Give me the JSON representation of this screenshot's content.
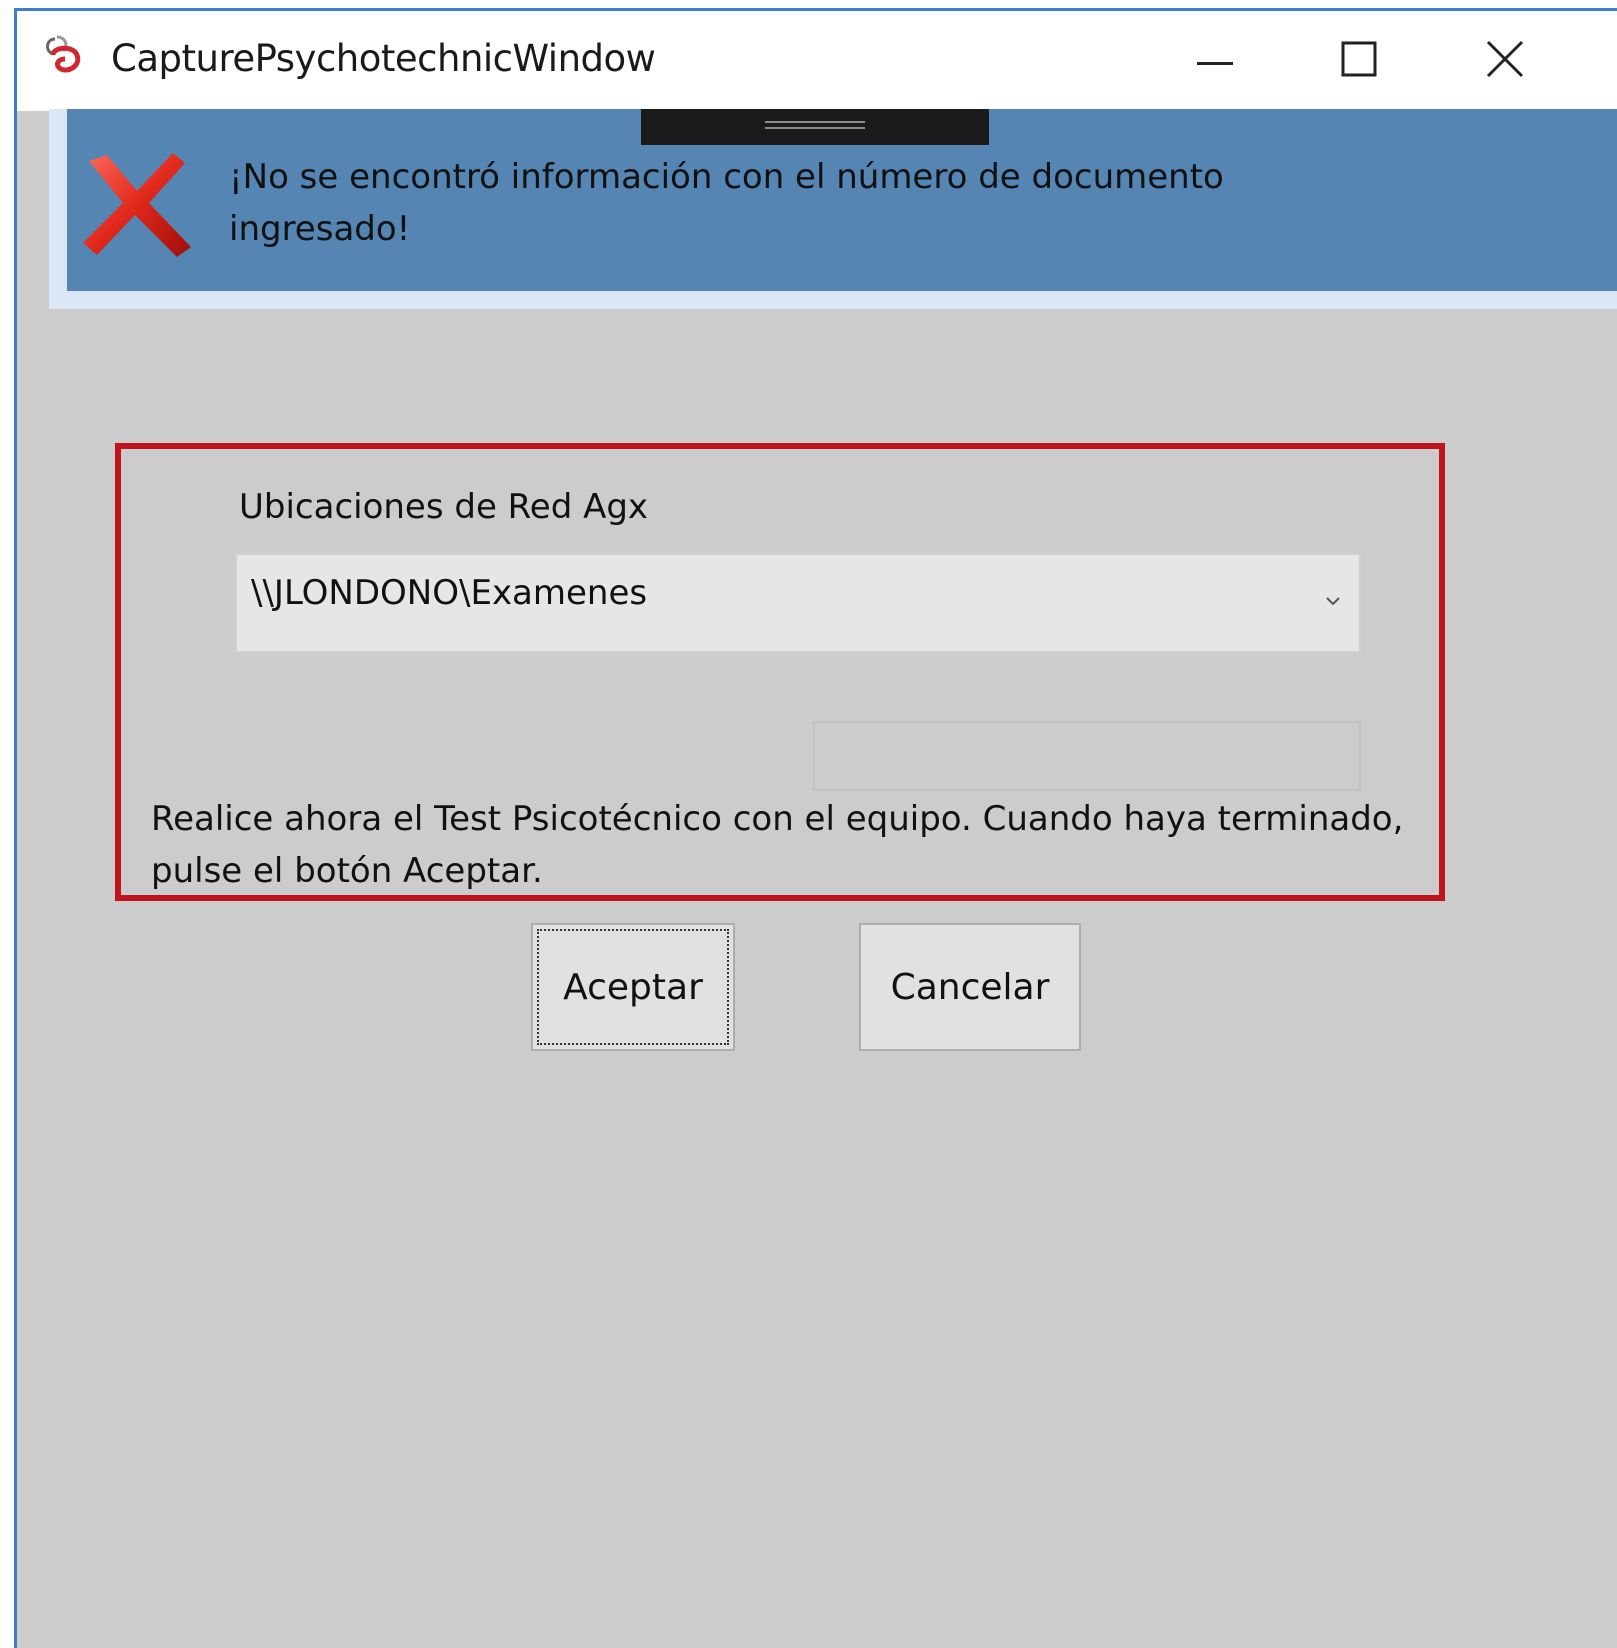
{
  "window": {
    "title": "CapturePsychotechnicWindow",
    "controls": {
      "minimize_icon": "minimize-icon",
      "maximize_icon": "maximize-icon",
      "close_icon": "close-icon"
    }
  },
  "notice": {
    "icon": "error-x-icon",
    "message": "¡No se encontró información con el número de documento ingresado!",
    "background_color": "#5585b2"
  },
  "form": {
    "locations_label": "Ubicaciones de Red Agx",
    "locations_selected": "\\\\JLONDONO\\Examenes",
    "secondary_field_value": "",
    "instructions": "Realice ahora el Test Psicotécnico con el equipo. Cuando haya terminado, pulse el botón Aceptar.",
    "highlight_color": "#c0141c"
  },
  "buttons": {
    "accept_label": "Aceptar",
    "cancel_label": "Cancelar"
  }
}
